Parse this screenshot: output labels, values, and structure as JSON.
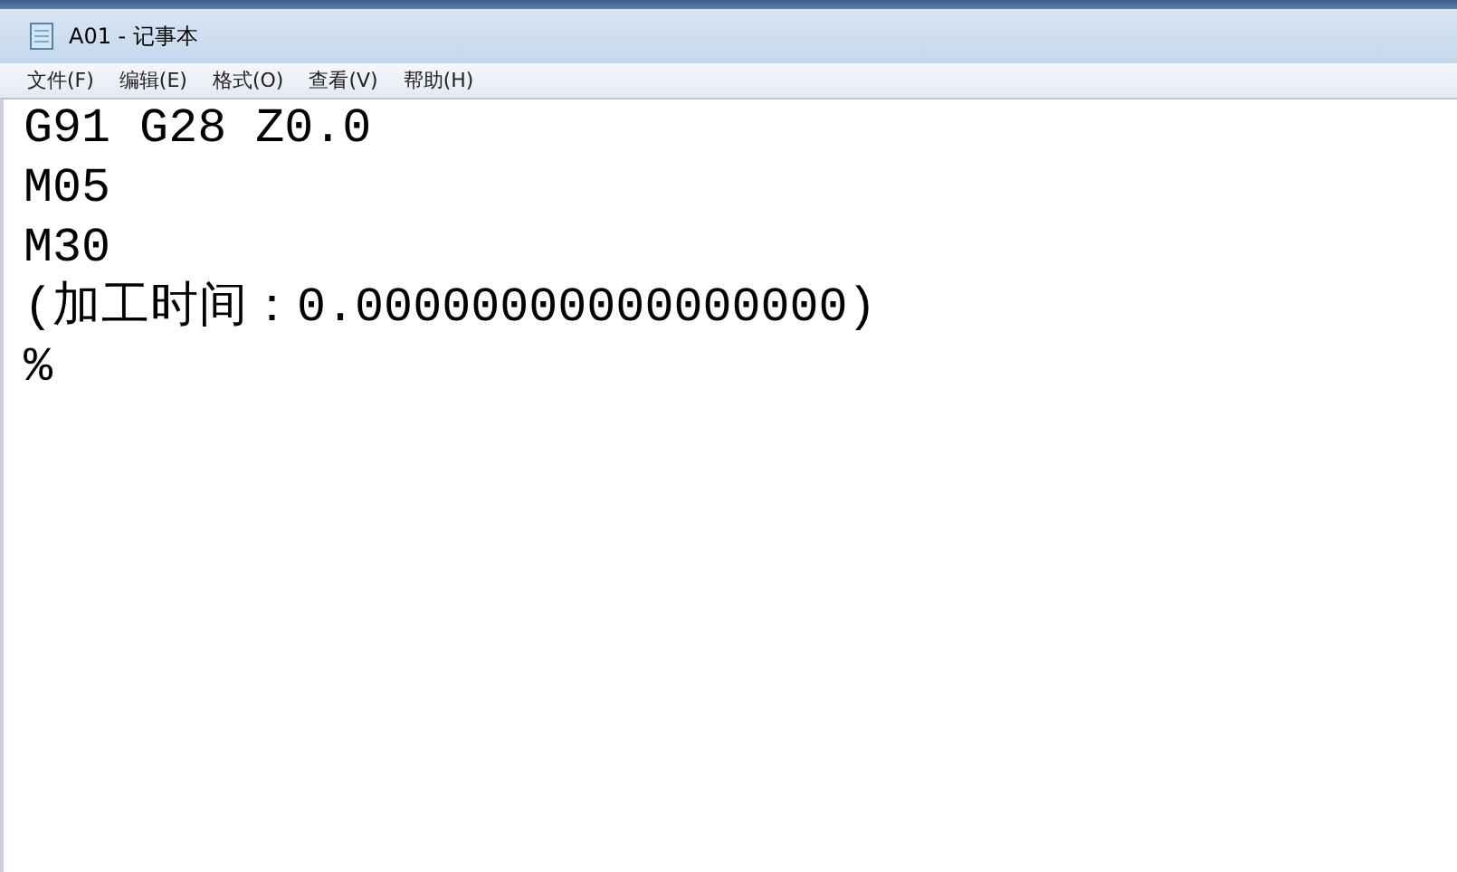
{
  "window": {
    "title": "A01 - 记事本"
  },
  "menu": [
    {
      "label": "文件(F)"
    },
    {
      "label": "编辑(E)"
    },
    {
      "label": "格式(O)"
    },
    {
      "label": "查看(V)"
    },
    {
      "label": "帮助(H)"
    }
  ],
  "document": {
    "lines": [
      "G91 G28 Z0.0",
      "M05",
      "M30",
      "(加工时间：0.00000000000000000)",
      "%"
    ]
  }
}
